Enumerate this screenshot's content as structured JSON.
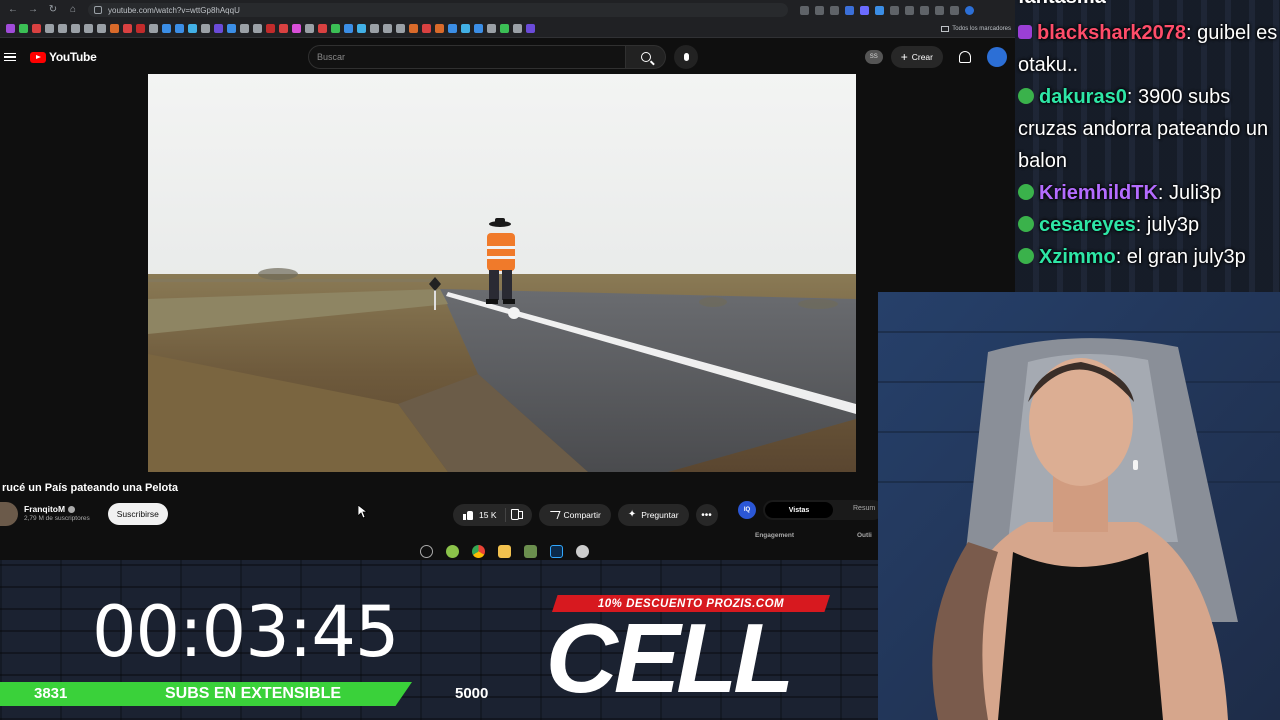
{
  "browser": {
    "url": "youtube.com/watch?v=wttGp8hAqqU",
    "bookmarks_all_label": "Todos los marcadores"
  },
  "youtube": {
    "logo_text": "YouTube",
    "search_placeholder": "Buscar",
    "ss_badge": "SS",
    "create_label": "Crear"
  },
  "video": {
    "title": "rucé un País pateando una Pelota",
    "channel_name": "FranqitoM",
    "channel_subs": "2,79 M de suscriptores",
    "subscribe_label": "Suscribirse",
    "likes": "15 K",
    "share_label": "Compartir",
    "ask_label": "Preguntar",
    "more_label": "•••"
  },
  "side_panel": {
    "icon_text": "IQ",
    "tab_active": "Vistas",
    "tab_other": "Resum",
    "label_left": "Engagement",
    "label_right": "Outli"
  },
  "chat": {
    "top_fragment": "fantasma",
    "messages": [
      {
        "user": "blackshark2078",
        "user_color": "#ff4d6a",
        "text": ": guibel es otaku..",
        "badge": "purple"
      },
      {
        "user": "dakuras0",
        "user_color": "#2ee6a6",
        "text": ": 3900 subs cruzas andorra pateando un balon",
        "badge": "green"
      },
      {
        "user": "KriemhildTK",
        "user_color": "#b46cff",
        "text": ": Juli3p",
        "badge": "green"
      },
      {
        "user": "cesareyes",
        "user_color": "#2ee6a6",
        "text": ": july3p",
        "badge": "green"
      },
      {
        "user": "Xzimmo",
        "user_color": "#2ee6a6",
        "text": ": el gran july3p",
        "badge": "green"
      }
    ]
  },
  "overlay": {
    "timer": "00:03:45",
    "subs_current": "3831",
    "subs_label": "SUBS EN EXTENSIBLE",
    "subs_goal": "5000",
    "promo_text": "10% DESCUENTO PROZIS.COM",
    "cell_text": "CELL"
  },
  "colors": {
    "yt_red": "#ff0000",
    "subs_green": "#3ad13a",
    "promo_red": "#d7191f"
  }
}
